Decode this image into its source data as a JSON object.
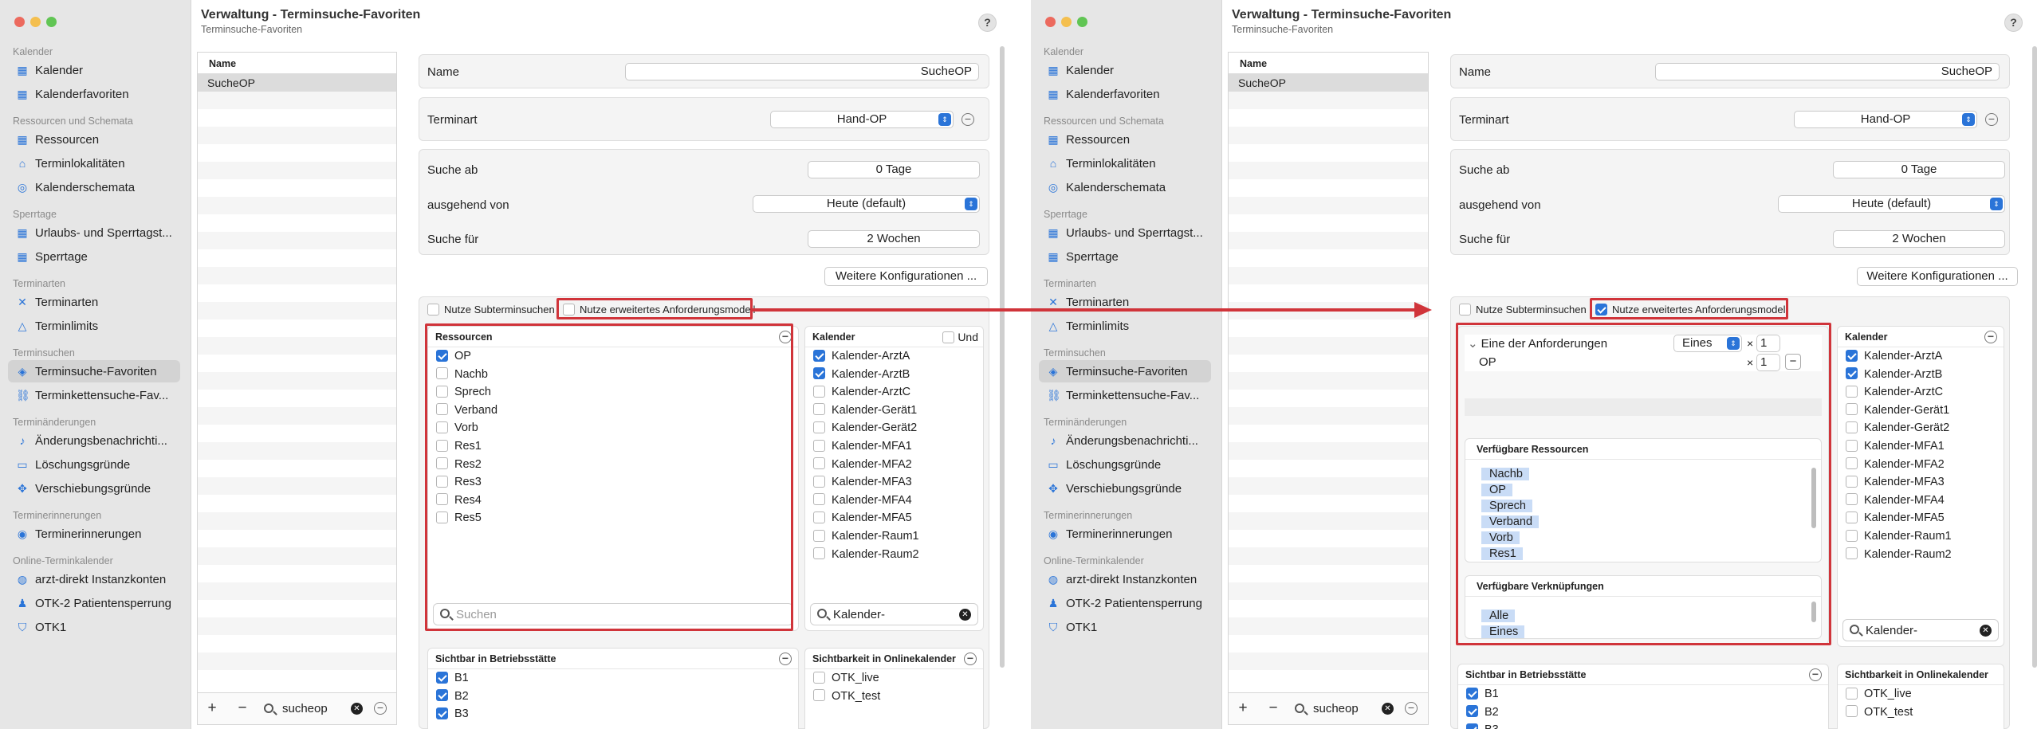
{
  "window": {
    "title": "Verwaltung - Terminsuche-Favoriten",
    "subtitle": "Terminsuche-Favoriten",
    "help": "?"
  },
  "sidebar": {
    "sections": [
      {
        "label": "Kalender",
        "items": [
          {
            "label": "Kalender",
            "icon": "calendar-icon"
          },
          {
            "label": "Kalenderfavoriten",
            "icon": "calendar-icon"
          }
        ]
      },
      {
        "label": "Ressourcen und Schemata",
        "items": [
          {
            "label": "Ressourcen",
            "icon": "grid-icon"
          },
          {
            "label": "Terminlokalitäten",
            "icon": "house-icon"
          },
          {
            "label": "Kalenderschemata",
            "icon": "palette-icon"
          }
        ]
      },
      {
        "label": "Sperrtage",
        "items": [
          {
            "label": "Urlaubs- und Sperrtagst...",
            "icon": "calendar-icon"
          },
          {
            "label": "Sperrtage",
            "icon": "calendar-icon"
          }
        ]
      },
      {
        "label": "Terminarten",
        "items": [
          {
            "label": "Terminarten",
            "icon": "shapes-icon"
          },
          {
            "label": "Terminlimits",
            "icon": "warning-icon"
          }
        ]
      },
      {
        "label": "Terminsuchen",
        "items": [
          {
            "label": "Terminsuche-Favoriten",
            "icon": "star-calendar-icon"
          },
          {
            "label": "Terminkettensuche-Fav...",
            "icon": "chain-icon"
          }
        ]
      },
      {
        "label": "Terminänderungen",
        "items": [
          {
            "label": "Änderungsbenachrichti...",
            "icon": "bell-icon"
          },
          {
            "label": "Löschungsgründe",
            "icon": "trash-box-icon"
          },
          {
            "label": "Verschiebungsgründe",
            "icon": "move-icon"
          }
        ]
      },
      {
        "label": "Terminerinnerungen",
        "items": [
          {
            "label": "Terminerinnerungen",
            "icon": "signal-icon"
          }
        ]
      },
      {
        "label": "Online-Terminkalender",
        "items": [
          {
            "label": "arzt-direkt Instanzkonten",
            "icon": "globe-icon"
          },
          {
            "label": "OTK-2 Patientensperrung",
            "icon": "person-icon"
          },
          {
            "label": "OTK1",
            "icon": "shield-icon"
          }
        ]
      }
    ]
  },
  "list": {
    "header": "Name",
    "rows": [
      "SucheOP"
    ],
    "search_value": "sucheop",
    "add": "+",
    "remove": "−",
    "more": "⋯"
  },
  "form": {
    "name_label": "Name",
    "name_value": "SucheOP",
    "terminart_label": "Terminart",
    "terminart_value": "Hand-OP",
    "suche_ab_label": "Suche ab",
    "suche_ab_value": "0 Tage",
    "ausgehend_label": "ausgehend von",
    "ausgehend_value": "Heute (default)",
    "suche_fuer_label": "Suche für",
    "suche_fuer_value": "2 Wochen",
    "weitere_button": "Weitere Konfigurationen ...",
    "subterminsuchen": "Nutze Subterminsuchen",
    "erweitert": "Nutze erweitertes Anforderungsmodell"
  },
  "resources_box": {
    "title": "Ressourcen",
    "items": [
      {
        "label": "OP",
        "checked": true
      },
      {
        "label": "Nachb",
        "checked": false
      },
      {
        "label": "Sprech",
        "checked": false
      },
      {
        "label": "Verband",
        "checked": false
      },
      {
        "label": "Vorb",
        "checked": false
      },
      {
        "label": "Res1",
        "checked": false
      },
      {
        "label": "Res2",
        "checked": false
      },
      {
        "label": "Res3",
        "checked": false
      },
      {
        "label": "Res4",
        "checked": false
      },
      {
        "label": "Res5",
        "checked": false
      }
    ],
    "search_placeholder": "Suchen"
  },
  "calendar_box": {
    "title": "Kalender",
    "und": "Und",
    "items": [
      {
        "label": "Kalender-ArztA",
        "checked": true
      },
      {
        "label": "Kalender-ArztB",
        "checked": true
      },
      {
        "label": "Kalender-ArztC",
        "checked": false
      },
      {
        "label": "Kalender-Gerät1",
        "checked": false
      },
      {
        "label": "Kalender-Gerät2",
        "checked": false
      },
      {
        "label": "Kalender-MFA1",
        "checked": false
      },
      {
        "label": "Kalender-MFA2",
        "checked": false
      },
      {
        "label": "Kalender-MFA3",
        "checked": false
      },
      {
        "label": "Kalender-MFA4",
        "checked": false
      },
      {
        "label": "Kalender-MFA5",
        "checked": false
      },
      {
        "label": "Kalender-Raum1",
        "checked": false
      },
      {
        "label": "Kalender-Raum2",
        "checked": false
      }
    ],
    "search_value": "Kalender-"
  },
  "sichtbar_box": {
    "title": "Sichtbar in Betriebsstätte",
    "items": [
      {
        "label": "B1",
        "checked": true
      },
      {
        "label": "B2",
        "checked": true
      },
      {
        "label": "B3",
        "checked": true
      }
    ]
  },
  "online_box": {
    "title": "Sichtbarkeit in Onlinekalender",
    "items": [
      {
        "label": "OTK_live",
        "checked": false
      },
      {
        "label": "OTK_test",
        "checked": false
      }
    ]
  },
  "requirement_model": {
    "group_label": "Eine der Anforderungen",
    "group_mode": "Eines",
    "times": "×",
    "group_count": "1",
    "item_label": "OP",
    "item_count": "1",
    "item_remove": "−",
    "available_resources_title": "Verfügbare Ressourcen",
    "available_resources": [
      "Nachb",
      "OP",
      "Sprech",
      "Verband",
      "Vorb",
      "Res1"
    ],
    "available_links_title": "Verfügbare Verknüpfungen",
    "available_links": [
      "Alle",
      "Eines"
    ]
  },
  "colors": {
    "accent": "#2a74d8",
    "highlight": "#d0343a",
    "tag": "#c9dcf6"
  }
}
